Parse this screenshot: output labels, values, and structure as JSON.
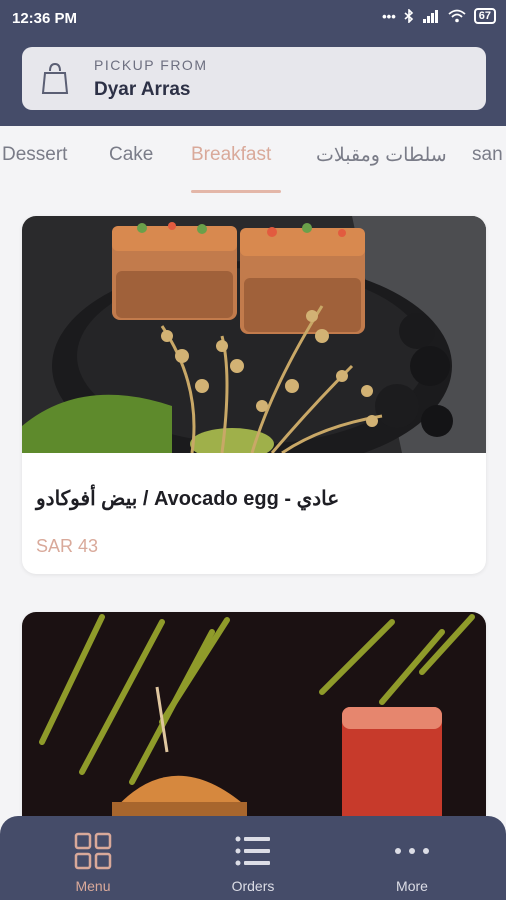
{
  "status_bar": {
    "time": "12:36 PM",
    "battery": "67",
    "dots": "•••"
  },
  "pickup": {
    "caption": "PICKUP FROM",
    "location": "Dyar Arras"
  },
  "tabs": [
    {
      "label": "Dessert",
      "active": false
    },
    {
      "label": "Cake",
      "active": false
    },
    {
      "label": "Breakfast",
      "active": true
    },
    {
      "label": "سلطات ومقبلات",
      "active": false
    },
    {
      "label": "san",
      "active": false
    }
  ],
  "items": [
    {
      "name": "بيض أفوكادو / Avocado egg - عادي",
      "price": "SAR 43"
    },
    {
      "name": "",
      "price": ""
    }
  ],
  "bottom_nav": [
    {
      "label": "Menu",
      "icon": "grid-icon",
      "active": true
    },
    {
      "label": "Orders",
      "icon": "list-icon",
      "active": false
    },
    {
      "label": "More",
      "icon": "more-dots-icon",
      "active": false
    }
  ],
  "colors": {
    "header": "#454c69",
    "accent": "#d9a99a",
    "background": "#f4f4f6"
  }
}
